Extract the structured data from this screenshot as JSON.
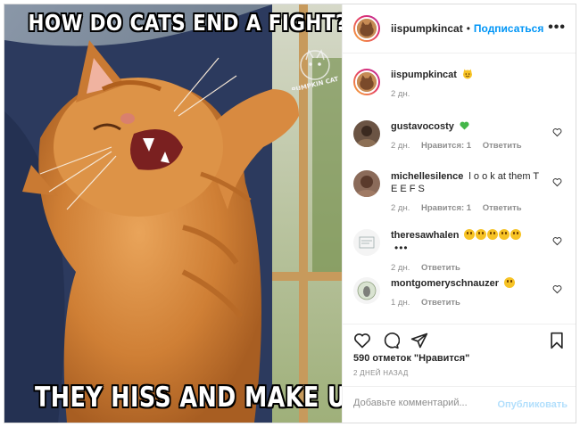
{
  "meme": {
    "top_text": "HOW DO CATS END A FIGHT?",
    "bottom_text": "THEY HISS AND MAKE UP!",
    "watermark_text": "PUMPKIN CAT"
  },
  "header": {
    "username": "iispumpkincat",
    "separator": "•",
    "follow_label": "Подписаться",
    "more_label": "•••"
  },
  "caption": {
    "username": "iispumpkincat",
    "emoji": "cat-smiling-emoji",
    "time": "2 дн."
  },
  "comments": [
    {
      "username": "gustavocosty",
      "text": "",
      "emoji": "green-heart-emoji",
      "time": "2 дн.",
      "likes": "Нравится: 1",
      "reply": "Ответить"
    },
    {
      "username": "michellesilence",
      "text": "l o o k at them T E E F S",
      "time": "2 дн.",
      "likes": "Нравится: 1",
      "reply": "Ответить"
    },
    {
      "username": "theresawhalen",
      "text": "",
      "emoji": "laughing-emojis",
      "ellipsis": "•••",
      "time": "2 дн.",
      "reply": "Ответить"
    },
    {
      "username": "montgomeryschnauzer",
      "text": "",
      "emoji": "laughing-emoji",
      "time": "1 дн.",
      "reply": "Ответить"
    }
  ],
  "footer": {
    "likes_count": "590 отметок \"Нравится\"",
    "date": "2 ДНЕЙ НАЗАД",
    "comment_placeholder": "Добавьте комментарий...",
    "publish_label": "Опубликовать"
  },
  "colors": {
    "accent": "#0095f6",
    "publish_disabled": "#b2dffc",
    "muted": "#8e8e8e",
    "text": "#262626"
  }
}
